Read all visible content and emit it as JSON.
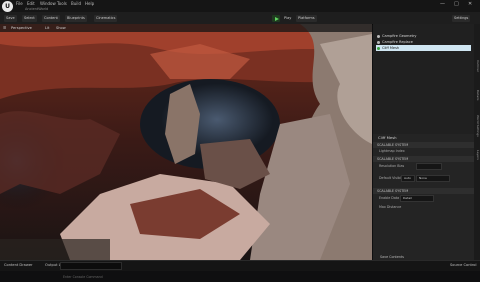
{
  "menu": [
    "File",
    "Edit",
    "Window",
    "Tools",
    "Build",
    "Help"
  ],
  "project_name": "AncientWorld",
  "window_controls": [
    "—",
    "□",
    "✕"
  ],
  "toolbar": {
    "save_label": "Save",
    "mode_label": "Select",
    "content_label": "Content",
    "blueprint_label": "Blueprints",
    "cinematics_label": "Cinematics",
    "play_label": "Play",
    "platforms_label": "Platforms",
    "settings_label": "Settings"
  },
  "viewport": {
    "perspective_label": "Perspective",
    "lit_label": "Lit",
    "show_label": "Show"
  },
  "outliner": {
    "items": [
      "Campfire Geometry",
      "Campfire Replace",
      "Cliff Mesh"
    ]
  },
  "details": {
    "title": "Cliff Mesh",
    "sections": [
      "SCALABLE SYSTEM",
      "SCALABLE SYSTEM",
      "SCALABLE SYSTEM"
    ],
    "labels": [
      "Lightmap Index",
      "Resolution Bias",
      "Default Visibility",
      "Hidden Bias",
      "Enable Data",
      "Max Distance"
    ],
    "field_value": "None",
    "auto_label": "Auto",
    "detail_label": "Detail",
    "section_footer": "Save Contents"
  },
  "side_tabs": [
    "Outliner",
    "Details",
    "World Settings",
    "Layers"
  ],
  "status": {
    "content_drawer": "Content Drawer",
    "output_log": "Output Log",
    "cmd_placeholder": "Enter Console Command",
    "source_control": "Source Control"
  },
  "colors": {
    "accent": "#5fd35f",
    "selection": "#cfe6f2"
  }
}
